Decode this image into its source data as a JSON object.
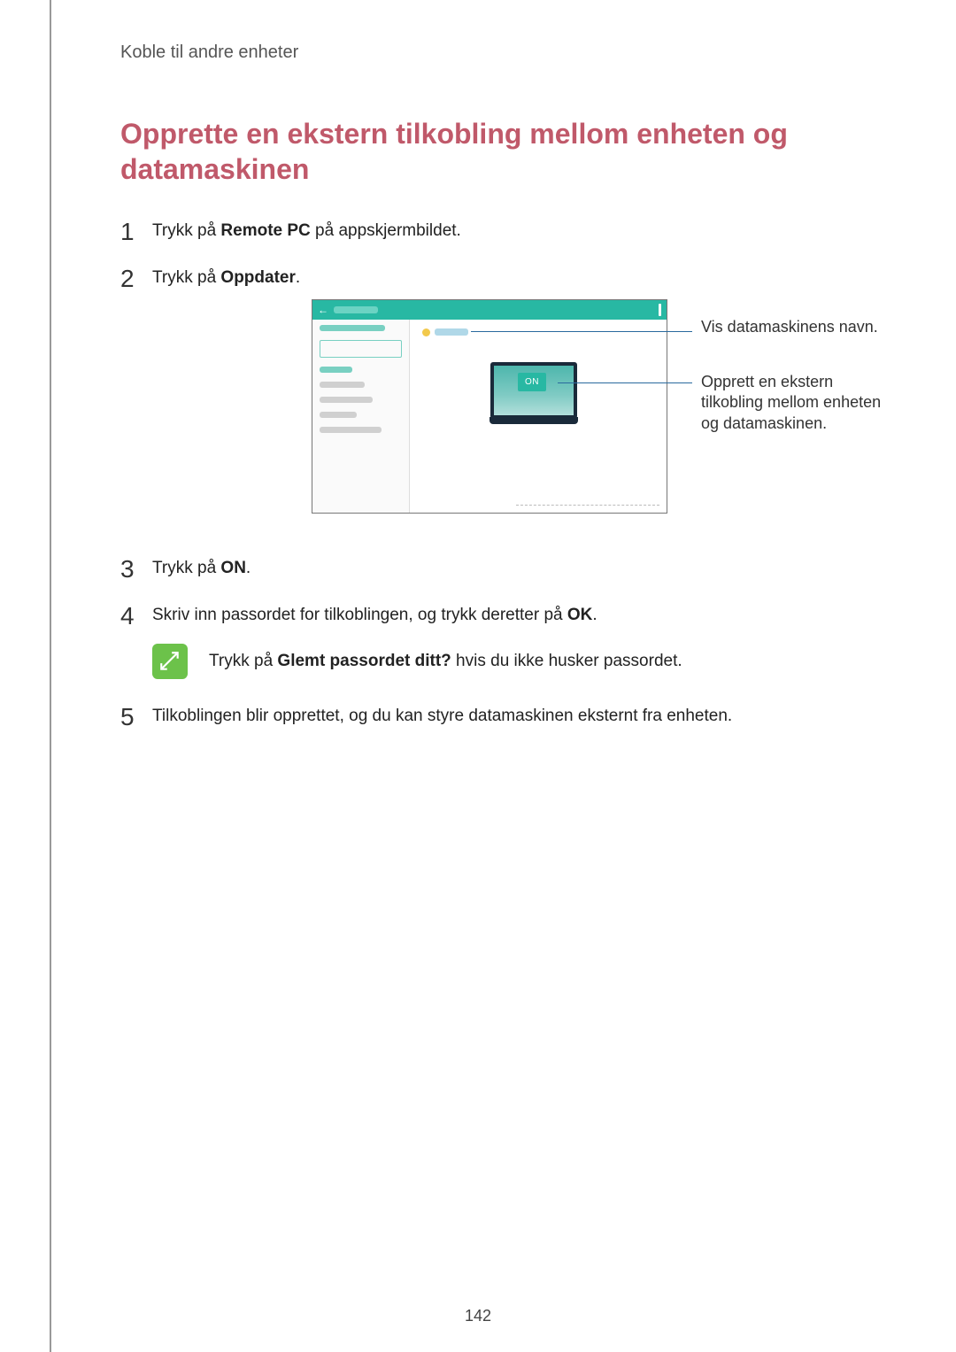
{
  "breadcrumb": "Koble til andre enheter",
  "title": "Opprette en ekstern tilkobling mellom enheten og datamaskinen",
  "steps": {
    "s1_pre": "Trykk på ",
    "s1_bold": "Remote PC",
    "s1_post": " på appskjermbildet.",
    "s2_pre": "Trykk på ",
    "s2_bold": "Oppdater",
    "s2_post": ".",
    "s3_pre": "Trykk på ",
    "s3_bold": "ON",
    "s3_post": ".",
    "s4_pre": "Skriv inn passordet for tilkoblingen, og trykk deretter på ",
    "s4_bold": "OK",
    "s4_post": ".",
    "s5": "Tilkoblingen blir opprettet, og du kan styre datamaskinen eksternt fra enheten."
  },
  "note": {
    "pre": "Trykk på ",
    "bold": "Glemt passordet ditt?",
    "post": " hvis du ikke husker passordet."
  },
  "figure": {
    "on_badge": "ON",
    "callout_name": "Vis datamaskinens navn.",
    "callout_connect": "Opprett en ekstern tilkobling mellom enheten og datamaskinen."
  },
  "page_number": "142"
}
